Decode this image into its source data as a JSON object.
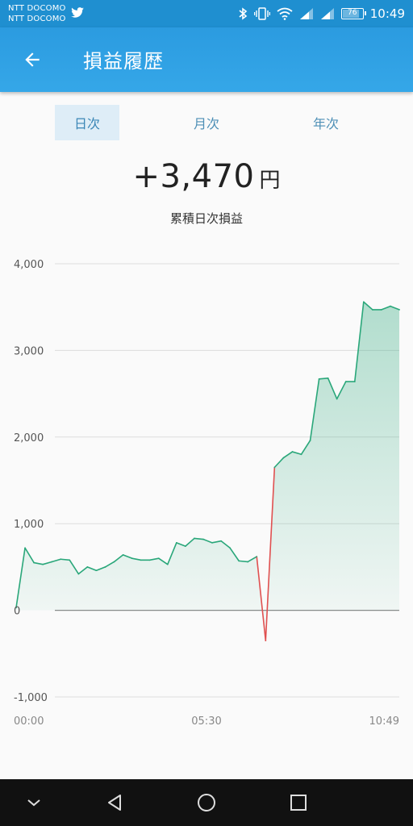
{
  "status_bar": {
    "carrier_1": "NTT DOCOMO",
    "carrier_2": "NTT DOCOMO",
    "battery": "76",
    "battery_level": 0.76,
    "time": "10:49",
    "icons": [
      "twitter-icon",
      "bluetooth-icon",
      "vibrate-icon",
      "wifi-icon",
      "signal-icon",
      "signal-icon",
      "battery-icon"
    ]
  },
  "app_bar": {
    "title": "損益履歴",
    "background": "#2b9be0"
  },
  "tabs": [
    {
      "label": "日次",
      "active": true
    },
    {
      "label": "月次",
      "active": false
    },
    {
      "label": "年次",
      "active": false
    }
  ],
  "summary": {
    "value": "+3,470",
    "unit": "円",
    "label": "累積日次損益"
  },
  "chart_data": {
    "type": "area",
    "ylim": [
      -1000,
      4000
    ],
    "y_ticks": [
      {
        "label": "4,000",
        "value": 4000
      },
      {
        "label": "3,000",
        "value": 3000
      },
      {
        "label": "2,000",
        "value": 2000
      },
      {
        "label": "1,000",
        "value": 1000
      },
      {
        "label": "0",
        "value": 0
      },
      {
        "label": "-1,000",
        "value": -1000
      }
    ],
    "x_ticks": [
      "00:00",
      "05:30",
      "10:49"
    ],
    "grid": true,
    "line_color": "#2aa77a",
    "negative_color": "#e05050",
    "values": [
      30,
      720,
      550,
      530,
      560,
      590,
      580,
      420,
      500,
      460,
      500,
      560,
      640,
      600,
      580,
      580,
      600,
      530,
      780,
      740,
      830,
      820,
      780,
      800,
      720,
      570,
      560,
      620,
      -350,
      1650,
      1760,
      1830,
      1800,
      1960,
      2670,
      2680,
      2440,
      2640,
      2640,
      3560,
      3470,
      3470,
      3510,
      3470
    ]
  },
  "nav_bar": {
    "buttons": [
      "chevron-down-icon",
      "back-triangle-icon",
      "home-circle-icon",
      "recents-square-icon"
    ]
  }
}
